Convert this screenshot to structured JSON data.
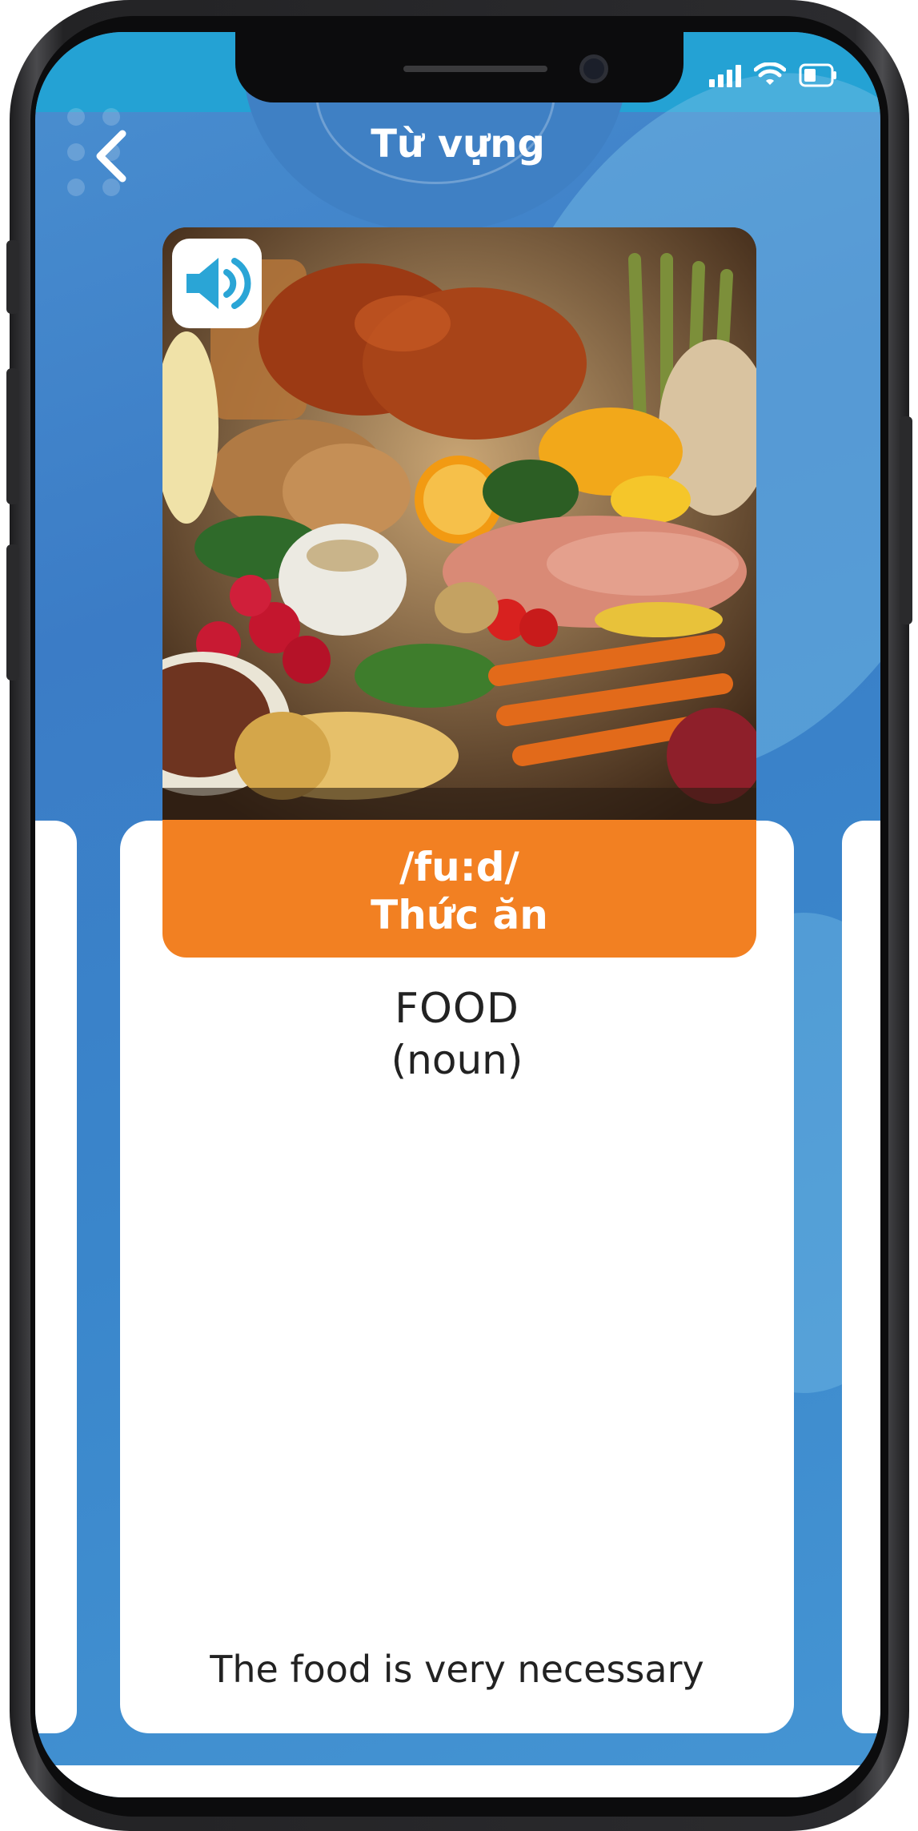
{
  "header": {
    "title": "Từ vựng"
  },
  "card": {
    "phonetic": "/fu:d/",
    "meaning": "Thức ăn",
    "word": "FOOD",
    "part_of_speech": "(noun)",
    "example": "The food is very necessary"
  },
  "colors": {
    "accent_orange": "#f28022",
    "background_blue": "#3b7cc6",
    "card_white": "#ffffff"
  },
  "icons": {
    "back": "chevron-left-icon",
    "sound": "speaker-icon",
    "signal": "cellular-signal-icon",
    "wifi": "wifi-icon",
    "battery": "battery-icon"
  }
}
